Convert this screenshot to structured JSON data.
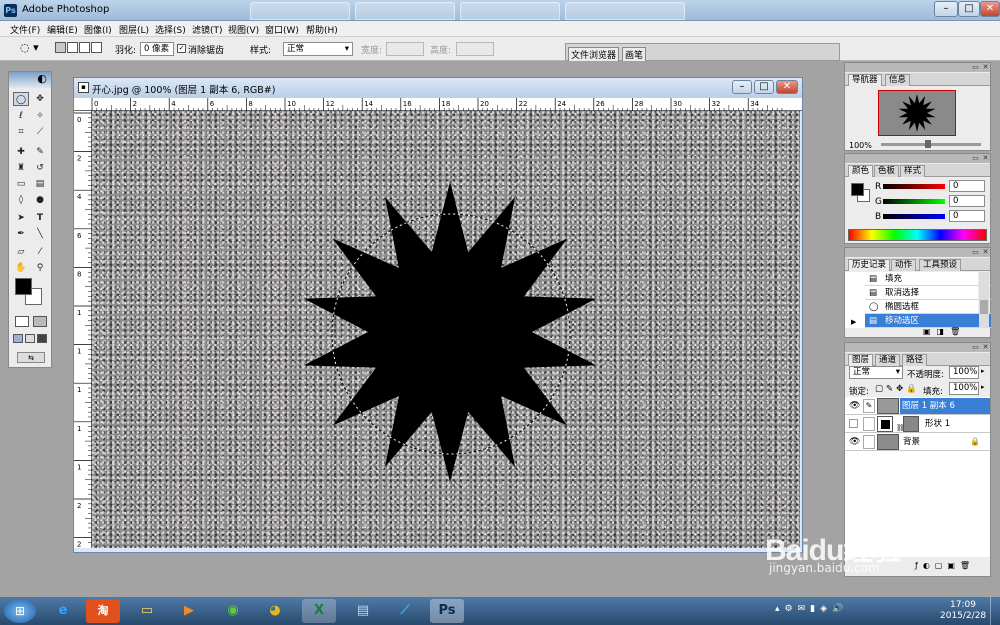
{
  "app": {
    "title": "Adobe Photoshop"
  },
  "menu": [
    "文件(F)",
    "编辑(E)",
    "图像(I)",
    "图层(L)",
    "选择(S)",
    "滤镜(T)",
    "视图(V)",
    "窗口(W)",
    "帮助(H)"
  ],
  "options": {
    "feather_label": "羽化:",
    "feather_value": "0 像素",
    "antialias_label": "消除锯齿",
    "style_label": "样式:",
    "style_value": "正常",
    "width_label": "宽度:",
    "height_label": "高度:",
    "palette_well_tabs": [
      "文件浏览器",
      "画笔"
    ]
  },
  "document": {
    "title": "开心.jpg @ 100% (图层 1 副本 6, RGB#)",
    "h_ruler": [
      "0",
      "2",
      "4",
      "6",
      "8",
      "10",
      "12",
      "14",
      "16",
      "18",
      "20",
      "22",
      "24",
      "26",
      "28",
      "30",
      "32",
      "34"
    ],
    "v_ruler": [
      "0",
      "2",
      "4",
      "6",
      "8",
      "1",
      "1",
      "1",
      "1",
      "1",
      "2",
      "2"
    ]
  },
  "navigator": {
    "tabs": [
      "导航器",
      "信息"
    ],
    "zoom": "100%"
  },
  "color": {
    "tabs": [
      "颜色",
      "色板",
      "样式"
    ],
    "channels": [
      {
        "label": "R",
        "value": "0",
        "color": "#c00000"
      },
      {
        "label": "G",
        "value": "0",
        "color": "#00a000"
      },
      {
        "label": "B",
        "value": "0",
        "color": "#0000c0"
      }
    ]
  },
  "history": {
    "tabs": [
      "历史记录",
      "动作",
      "工具预设"
    ],
    "items": [
      {
        "label": "填充",
        "icon": "document-icon",
        "selected": false
      },
      {
        "label": "取消选择",
        "icon": "document-icon",
        "selected": false
      },
      {
        "label": "椭圆选框",
        "icon": "ellipse-icon",
        "selected": false
      },
      {
        "label": "移动选区",
        "icon": "document-icon",
        "selected": true
      }
    ]
  },
  "layers": {
    "tabs": [
      "图层",
      "通道",
      "路径"
    ],
    "blend_mode": "正常",
    "opacity_label": "不透明度:",
    "opacity_value": "100%",
    "lock_label": "锁定:",
    "fill_label": "填充:",
    "fill_value": "100%",
    "items": [
      {
        "name": "图层 1 副本 6",
        "visible": true,
        "selected": true
      },
      {
        "name": "形状 1",
        "visible": false,
        "selected": false
      },
      {
        "name": "背景",
        "visible": true,
        "selected": false,
        "locked": true
      }
    ]
  },
  "watermark": {
    "brand": "Baidu经验",
    "url": "jingyan.baidu.com"
  },
  "taskbar": {
    "time": "17:09",
    "date": "2015/2/28",
    "apps": [
      "ie-icon",
      "taobao-icon",
      "explorer-icon",
      "media-player-icon",
      "360-icon",
      "chrome-icon",
      "excel-icon",
      "notepad-icon",
      "onenote-icon",
      "photoshop-icon"
    ]
  }
}
